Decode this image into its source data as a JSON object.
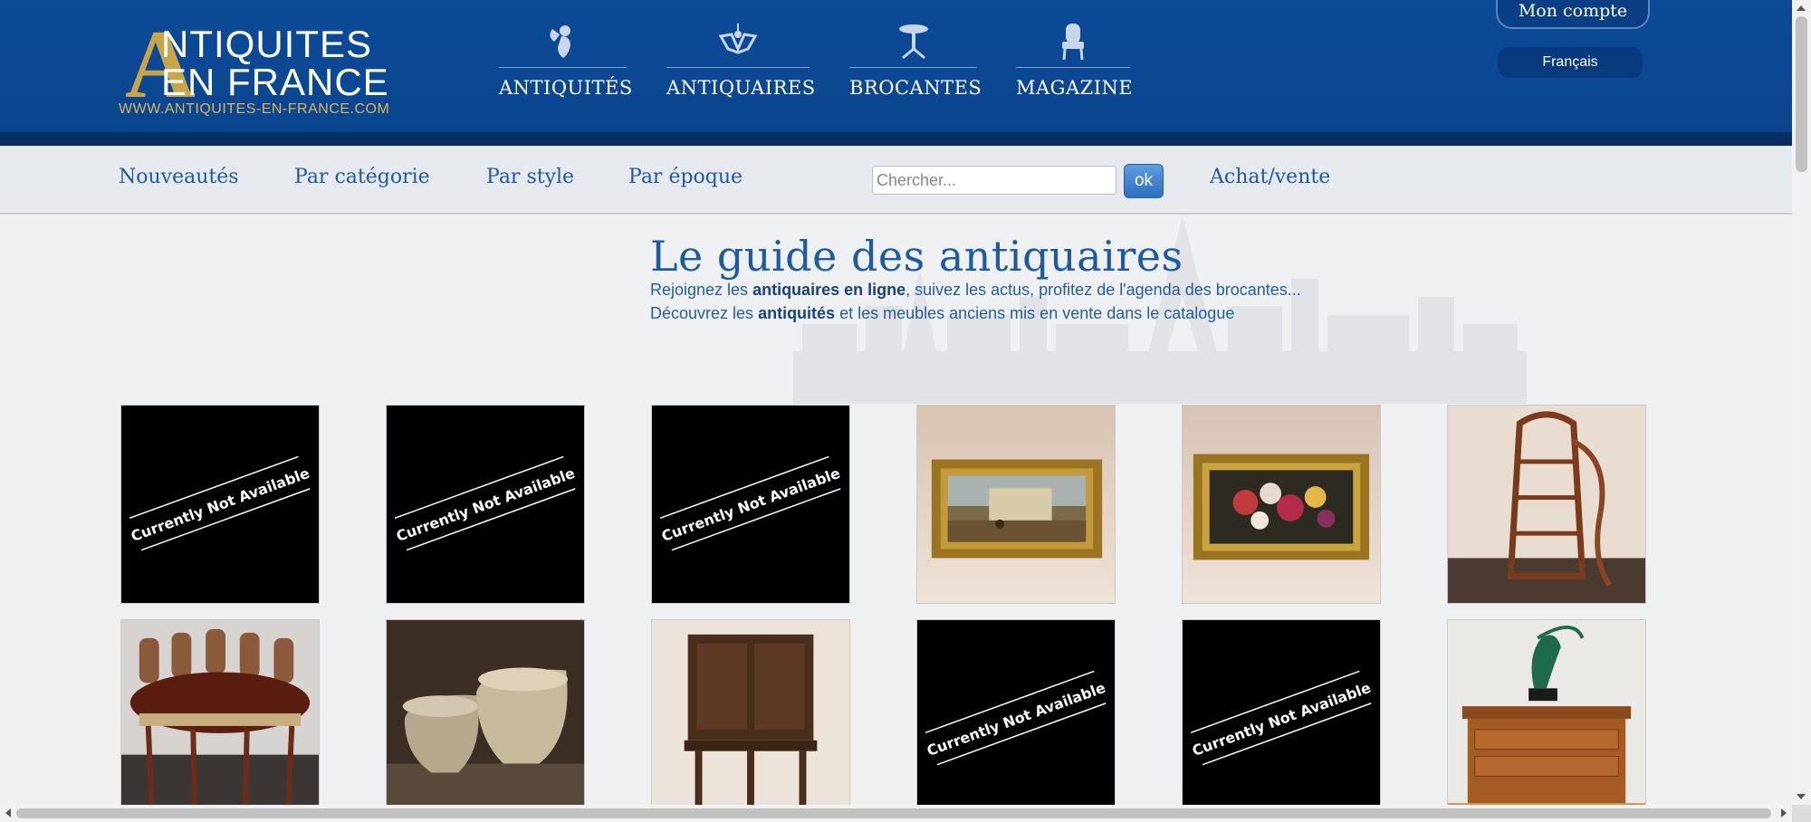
{
  "header": {
    "logo": {
      "initial": "A",
      "line1": "NTIQUITES",
      "line2": "EN FRANCE",
      "url": "WWW.ANTIQUITES-EN-FRANCE.COM"
    },
    "main_nav": [
      {
        "label": "ANTIQUITÉS",
        "icon": "cherub-icon"
      },
      {
        "label": "ANTIQUAIRES",
        "icon": "chandelier-icon"
      },
      {
        "label": "BROCANTES",
        "icon": "gueridon-table-icon"
      },
      {
        "label": "MAGAZINE",
        "icon": "armchair-icon"
      }
    ],
    "account_label": "Mon compte",
    "language_label": "Français"
  },
  "subnav": {
    "links": [
      "Nouveautés",
      "Par catégorie",
      "Par style",
      "Par époque"
    ],
    "search_placeholder": "Chercher...",
    "ok_label": "ok",
    "trade_link": "Achat/vente"
  },
  "hero": {
    "title": "Le guide des antiquaires",
    "line1": {
      "pre": "Rejoignez les ",
      "bold": "antiquaires en ligne",
      "post": ", suivez les actus, profitez de l'agenda des brocantes..."
    },
    "line2": {
      "pre": "Découvrez les ",
      "bold": "antiquités",
      "post": " et les meubles anciens mis en vente dans le catalogue"
    }
  },
  "products": [
    {
      "kind": "unavailable",
      "text": "Currently Not Available"
    },
    {
      "kind": "unavailable",
      "text": "Currently Not Available"
    },
    {
      "kind": "unavailable",
      "text": "Currently Not Available"
    },
    {
      "kind": "photo",
      "subject": "painting-village-gilt-frame"
    },
    {
      "kind": "photo",
      "subject": "painting-flowers-gilt-frame"
    },
    {
      "kind": "photo",
      "subject": "art-nouveau-etagere"
    },
    {
      "kind": "photo",
      "subject": "round-dining-table-chairs"
    },
    {
      "kind": "photo",
      "subject": "pair-stone-urns"
    },
    {
      "kind": "photo",
      "subject": "carved-oak-cabinet"
    },
    {
      "kind": "unavailable",
      "text": "Currently Not Available"
    },
    {
      "kind": "unavailable",
      "text": "Currently Not Available"
    },
    {
      "kind": "photo",
      "subject": "dancer-bronze-on-commode"
    }
  ],
  "colors": {
    "header_blue": "#0d4b97",
    "gold": "#c9a54a",
    "link_blue": "#1e5aa2"
  }
}
